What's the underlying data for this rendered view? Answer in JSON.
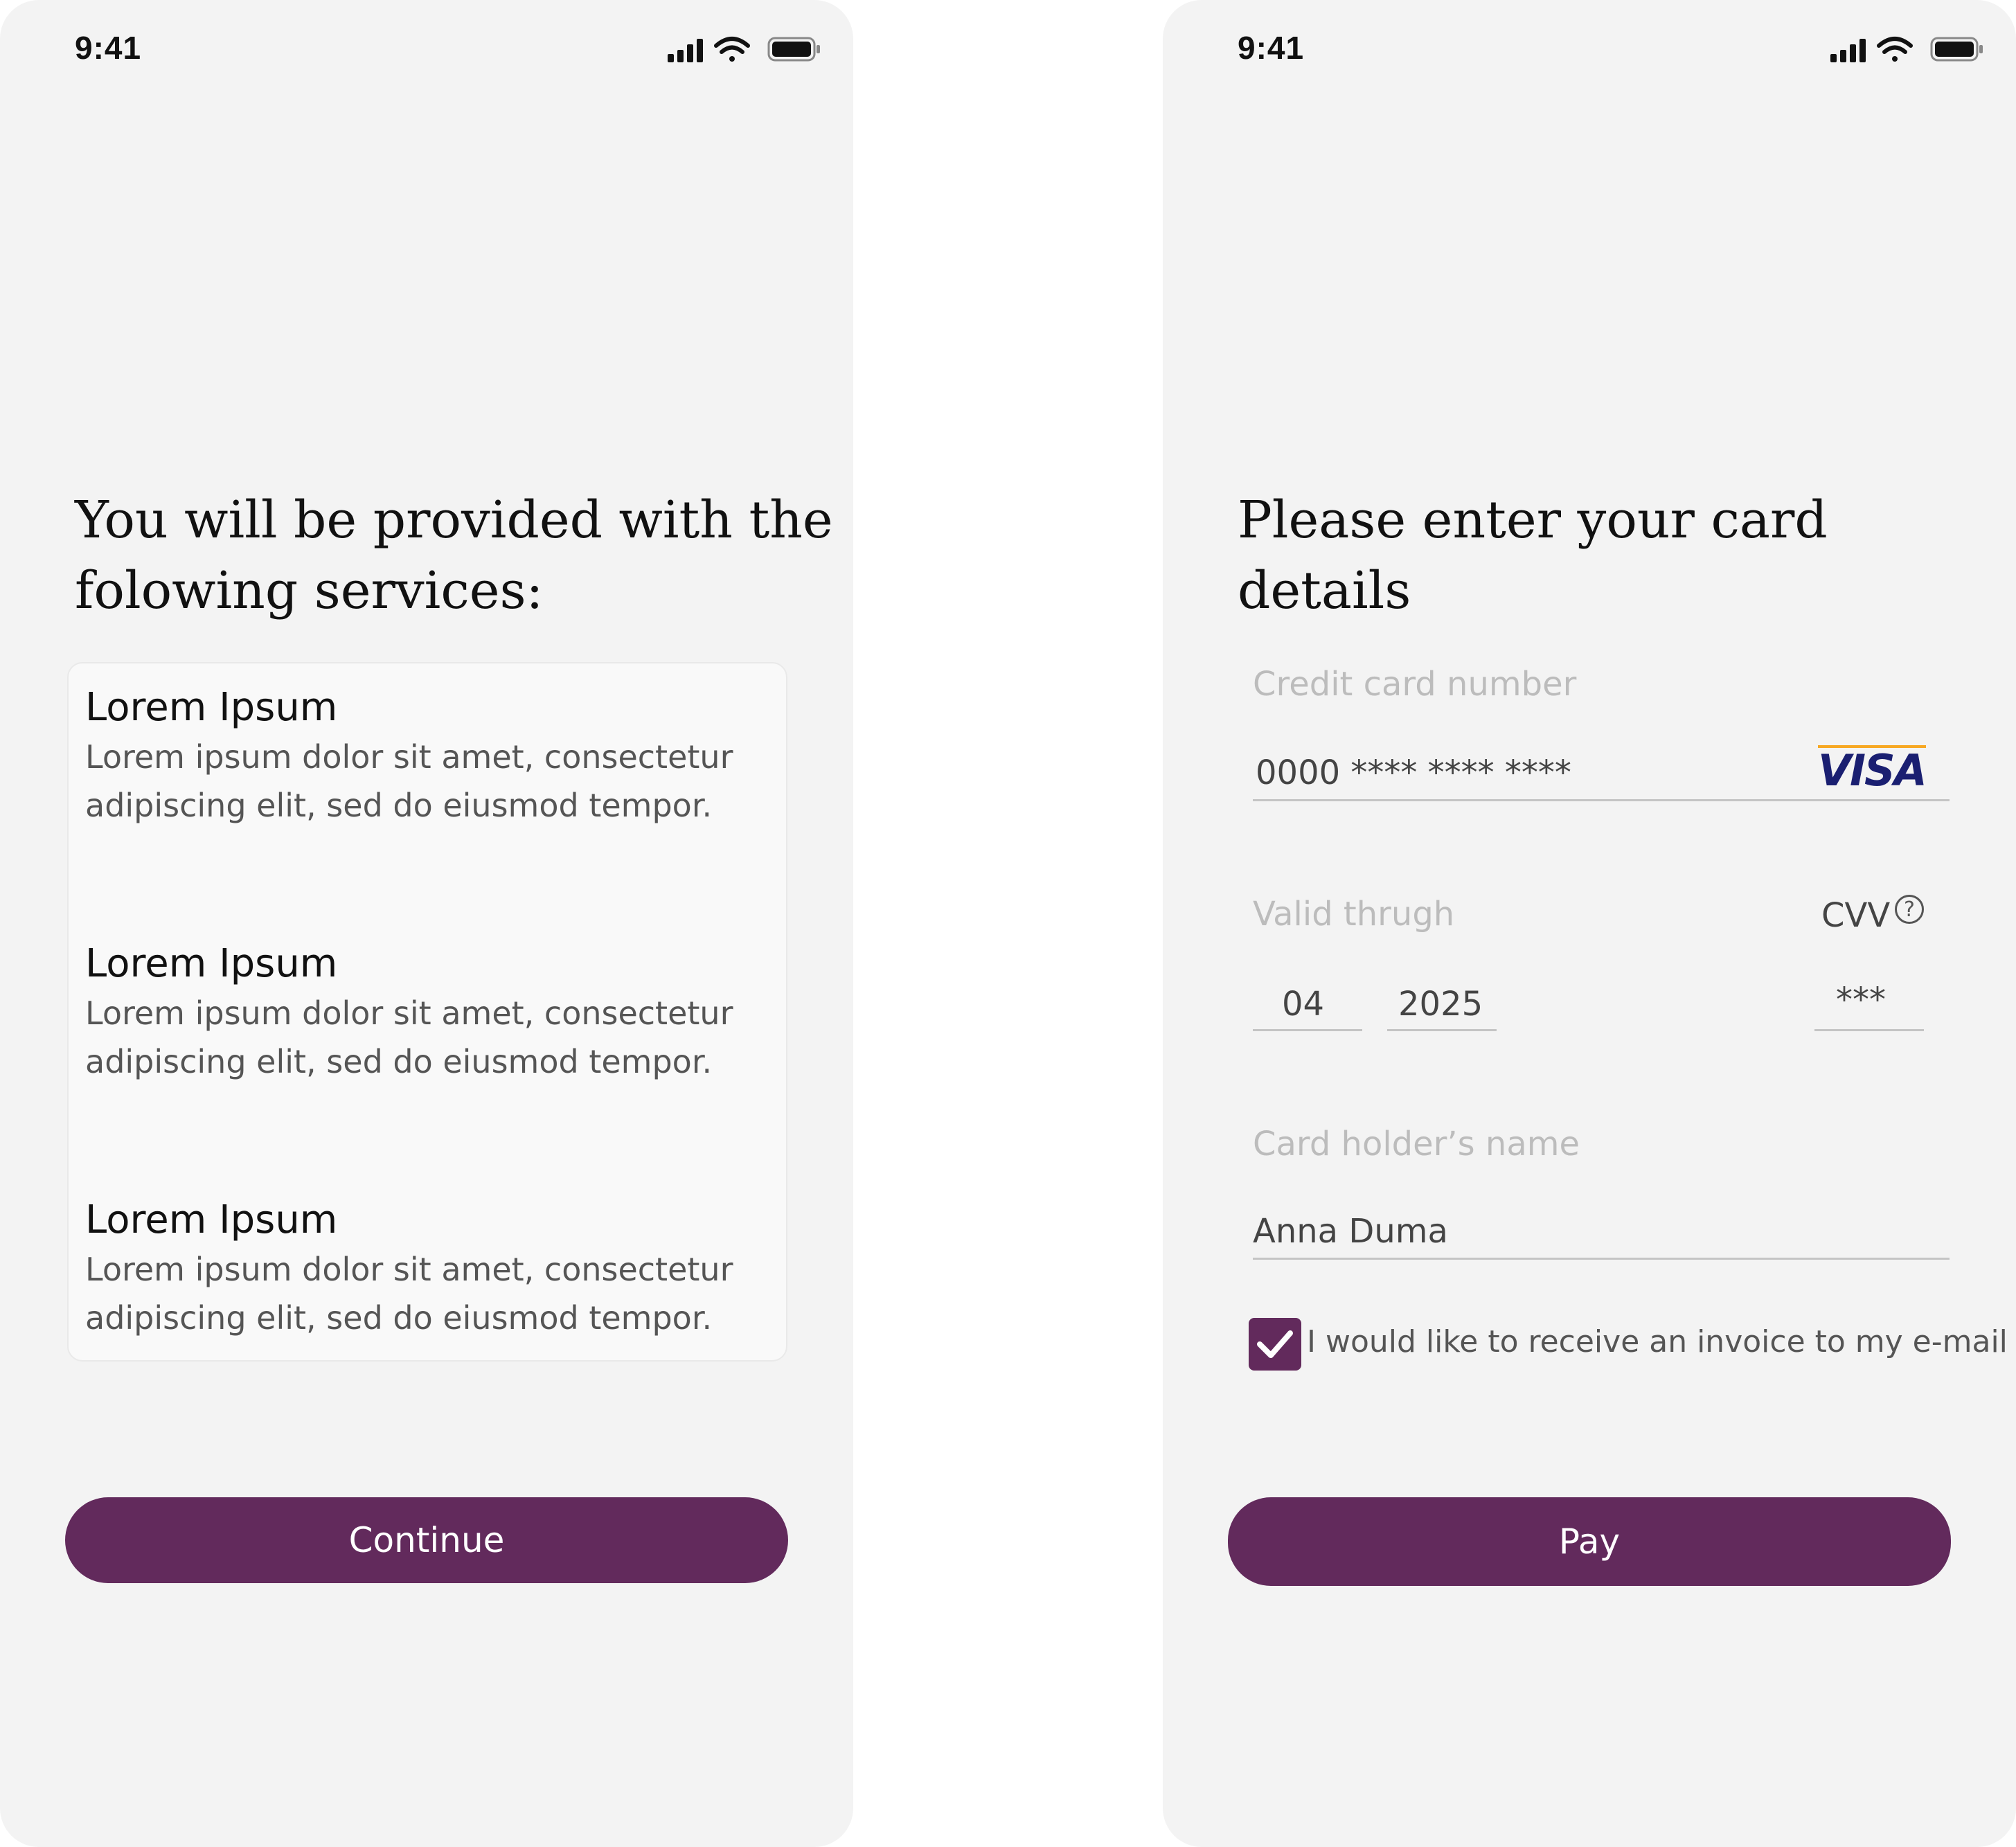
{
  "status_bar": {
    "time": "9:41"
  },
  "services_screen": {
    "heading_line1": "You will be provided with the",
    "heading_line2": "folowing services:",
    "services": [
      {
        "title": "Lorem Ipsum",
        "desc_line1": "Lorem ipsum dolor sit amet, consectetur",
        "desc_line2": "adipiscing elit, sed do eiusmod tempor."
      },
      {
        "title": "Lorem Ipsum",
        "desc_line1": "Lorem ipsum dolor sit amet, consectetur",
        "desc_line2": "adipiscing elit, sed do eiusmod tempor."
      },
      {
        "title": "Lorem Ipsum",
        "desc_line1": "Lorem ipsum dolor sit amet, consectetur",
        "desc_line2": "adipiscing elit, sed do eiusmod tempor."
      }
    ],
    "continue_label": "Continue"
  },
  "payment_screen": {
    "heading": "Please enter your card details",
    "card_number_label": "Credit card number",
    "card_number_value": "0000 **** **** ****",
    "card_brand": "VISA",
    "valid_through_label": "Valid thrugh",
    "cvv_label": "CVV",
    "help_glyph": "?",
    "month_value": "04",
    "year_value": "2025",
    "cvv_value": "***",
    "holder_label": "Card holder’s name",
    "holder_value": "Anna Duma",
    "invoice_checkbox": {
      "label": "I would like to receive an invoice to my e-mail",
      "checked": true
    },
    "pay_label": "Pay"
  },
  "colors": {
    "accent": "#622a5c",
    "visa_blue": "#1a1f71",
    "visa_gold": "#f7a823",
    "screen_bg": "#f3f3f3"
  },
  "icons": [
    "signal-icon",
    "wifi-icon",
    "battery-icon",
    "help-icon",
    "checkmark-icon"
  ]
}
